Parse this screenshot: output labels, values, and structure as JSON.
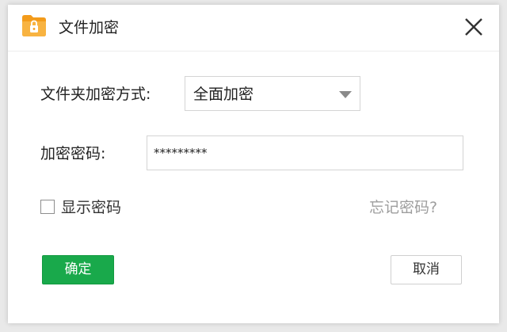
{
  "window": {
    "title": "文件加密",
    "close_label": "×"
  },
  "form": {
    "method_label": "文件夹加密方式:",
    "method_value": "全面加密",
    "password_label": "加密密码:",
    "password_value": "*********",
    "show_password_label": "显示密码",
    "show_password_checked": false,
    "forgot_password": "忘记密码?"
  },
  "buttons": {
    "ok": "确定",
    "cancel": "取消"
  },
  "colors": {
    "ok_button": "#19a94b",
    "app_icon_folder": "#f7a92c",
    "forgot_link": "#9e9e9e"
  }
}
